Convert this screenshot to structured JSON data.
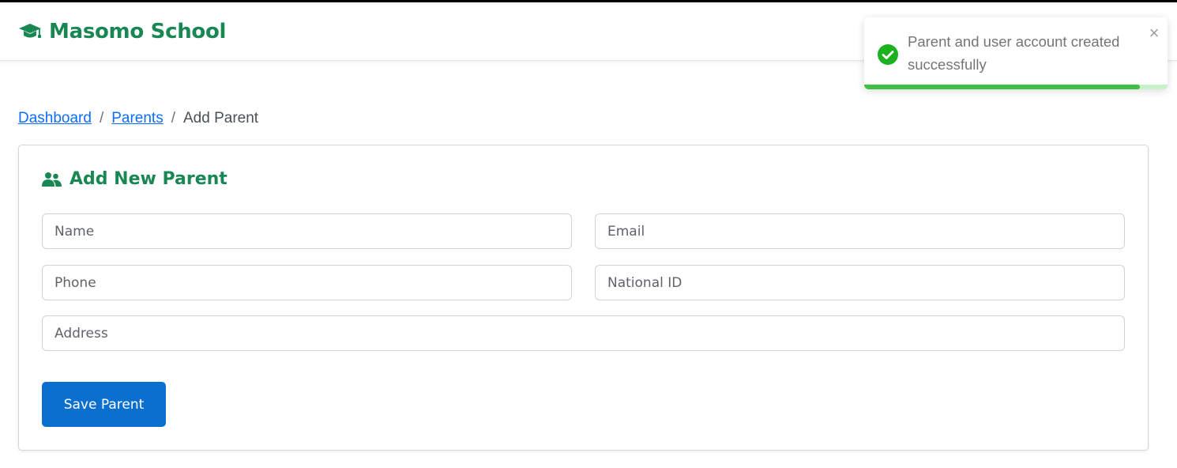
{
  "app": {
    "brand": "Masomo School",
    "brand_icon": "graduation-cap-icon",
    "brand_color": "#198754"
  },
  "breadcrumb": {
    "items": [
      {
        "label": "Dashboard",
        "link": true
      },
      {
        "label": "Parents",
        "link": true
      },
      {
        "label": "Add Parent",
        "link": false
      }
    ],
    "separator": "/"
  },
  "form": {
    "title": "Add New Parent",
    "title_icon": "users-icon",
    "fields": {
      "name": {
        "placeholder": "Name",
        "value": ""
      },
      "email": {
        "placeholder": "Email",
        "value": ""
      },
      "phone": {
        "placeholder": "Phone",
        "value": ""
      },
      "national_id": {
        "placeholder": "National ID",
        "value": ""
      },
      "address": {
        "placeholder": "Address",
        "value": ""
      }
    },
    "submit_label": "Save Parent",
    "submit_color": "#0b6fd0"
  },
  "toast": {
    "type": "success",
    "icon": "check-circle-icon",
    "message": "Parent and user account created successfully",
    "close_symbol": "×",
    "progress_percent": 91,
    "accent_color": "#3fbf44"
  }
}
